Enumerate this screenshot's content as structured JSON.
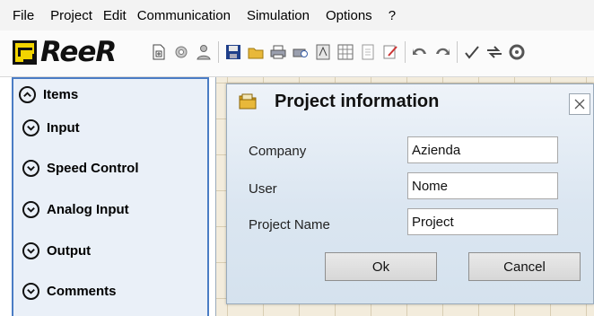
{
  "menu": {
    "file": "File",
    "project": "Project",
    "edit": "Edit",
    "communication": "Communication",
    "simulation": "Simulation",
    "options": "Options",
    "help": "?"
  },
  "logo": {
    "text": "ReeR"
  },
  "toolbar": {
    "icons": [
      "new-project-icon",
      "configure-icon",
      "user-icon",
      "save-icon",
      "open-icon",
      "print-icon",
      "print-preview-icon",
      "report-icon",
      "grid-icon",
      "page-icon",
      "edit-icon",
      "undo-icon",
      "redo-icon",
      "validate-icon",
      "transfer-icon",
      "connect-icon"
    ]
  },
  "items_panel": {
    "header": "Items",
    "sections": [
      "Input",
      "Speed Control",
      "Analog Input",
      "Output",
      "Comments"
    ]
  },
  "dialog": {
    "title": "Project information",
    "fields": [
      {
        "label": "Company",
        "value": "Azienda"
      },
      {
        "label": "User",
        "value": "Nome"
      },
      {
        "label": "Project Name",
        "value": "Project"
      }
    ],
    "ok_label": "Ok",
    "cancel_label": "Cancel"
  },
  "colors": {
    "accent": "#4a7cc4",
    "panel_bg": "#eaf0f8",
    "logo_yellow": "#f2d400",
    "work_bg": "#f3ecdc"
  }
}
